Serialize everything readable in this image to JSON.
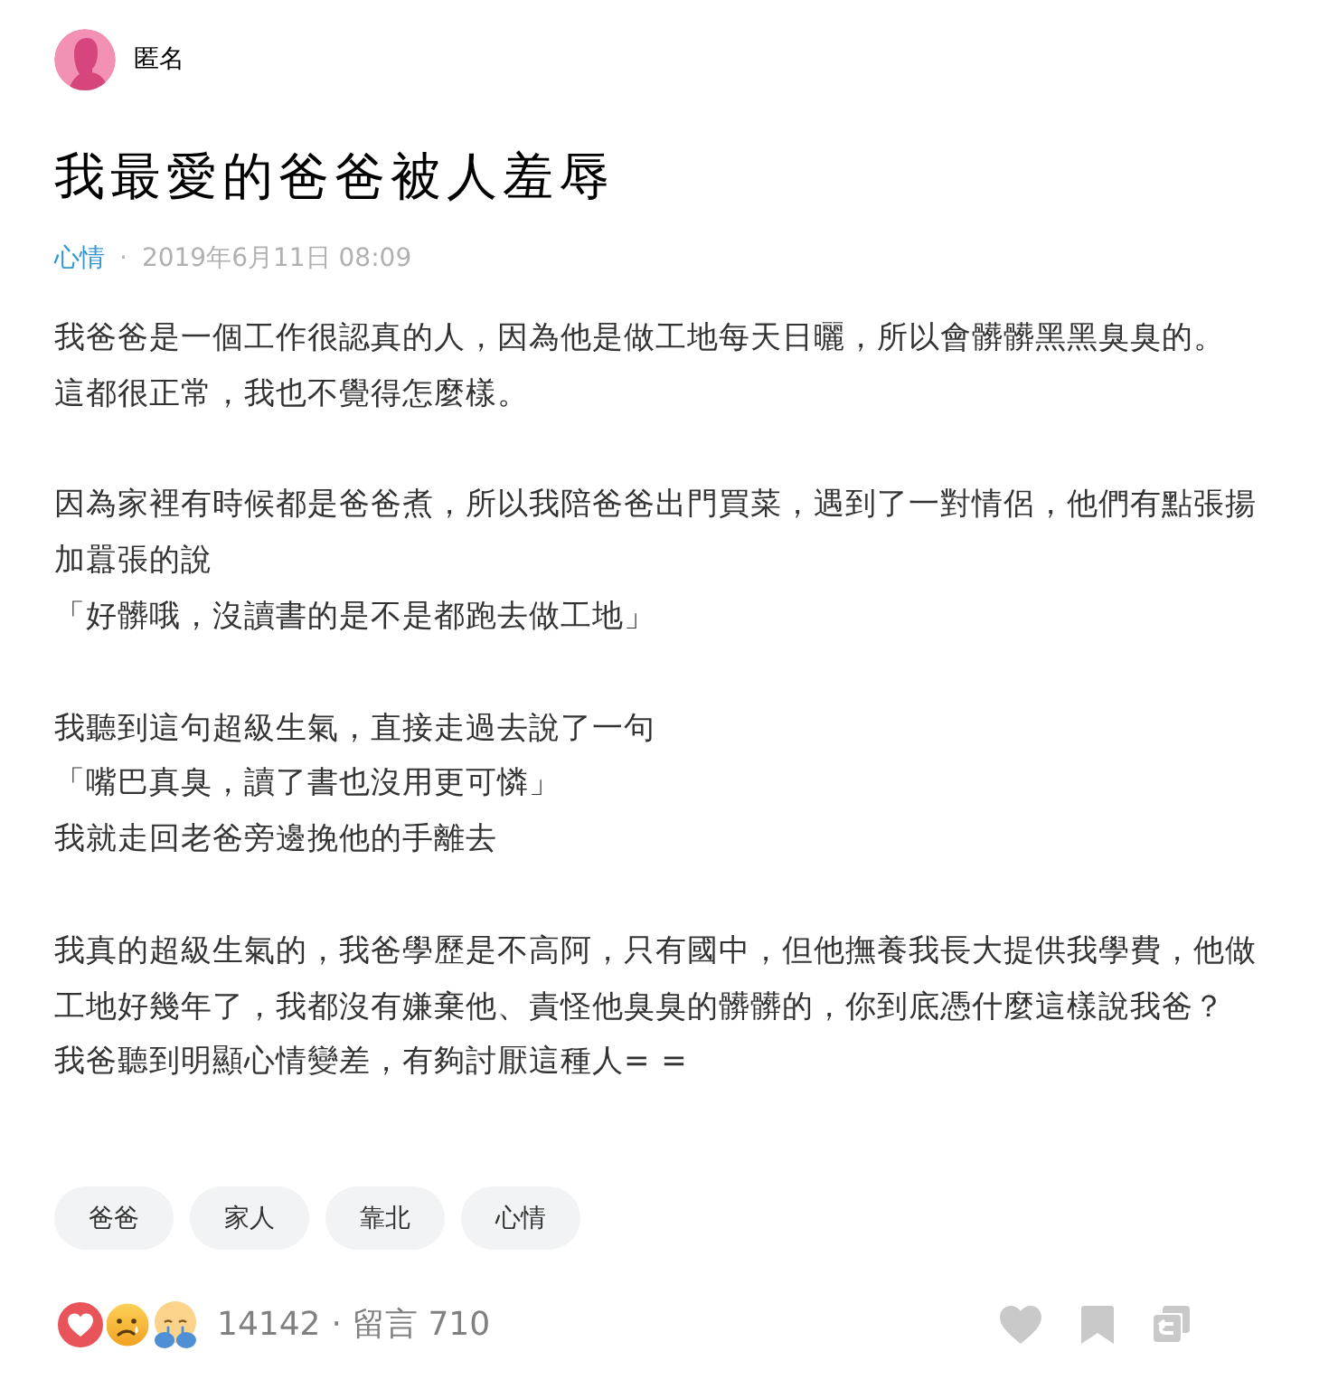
{
  "author": {
    "name": "匿名"
  },
  "title": "我最愛的爸爸被人羞辱",
  "meta": {
    "forum": "心情",
    "separator": "·",
    "posted": "2019年6月11日 08:09"
  },
  "body": [
    {
      "lines": [
        "我爸爸是一個工作很認真的人，因為他是做工地每天日曬，所以會髒髒黑黑臭臭的。",
        "這都很正常，我也不覺得怎麼樣。"
      ]
    },
    {
      "lines": [
        "因為家裡有時候都是爸爸煮，所以我陪爸爸出門買菜，遇到了一對情侶，他們有點張揚",
        "加囂張的說",
        "「好髒哦，沒讀書的是不是都跑去做工地」"
      ]
    },
    {
      "lines": [
        "我聽到這句超級生氣，直接走過去說了一句",
        "「嘴巴真臭，讀了書也沒用更可憐」",
        "我就走回老爸旁邊挽他的手離去"
      ]
    },
    {
      "lines": [
        "我真的超級生氣的，我爸學歷是不高阿，只有國中，但他撫養我長大提供我學費，他做",
        "工地好幾年了，我都沒有嫌棄他、責怪他臭臭的髒髒的，你到底憑什麼這樣說我爸？",
        "我爸聽到明顯心情變差，有夠討厭這種人= ="
      ]
    }
  ],
  "tags": [
    "爸爸",
    "家人",
    "靠北",
    "心情"
  ],
  "footer": {
    "reaction_count": "14142",
    "separator": "·",
    "comments": "留言 710"
  }
}
